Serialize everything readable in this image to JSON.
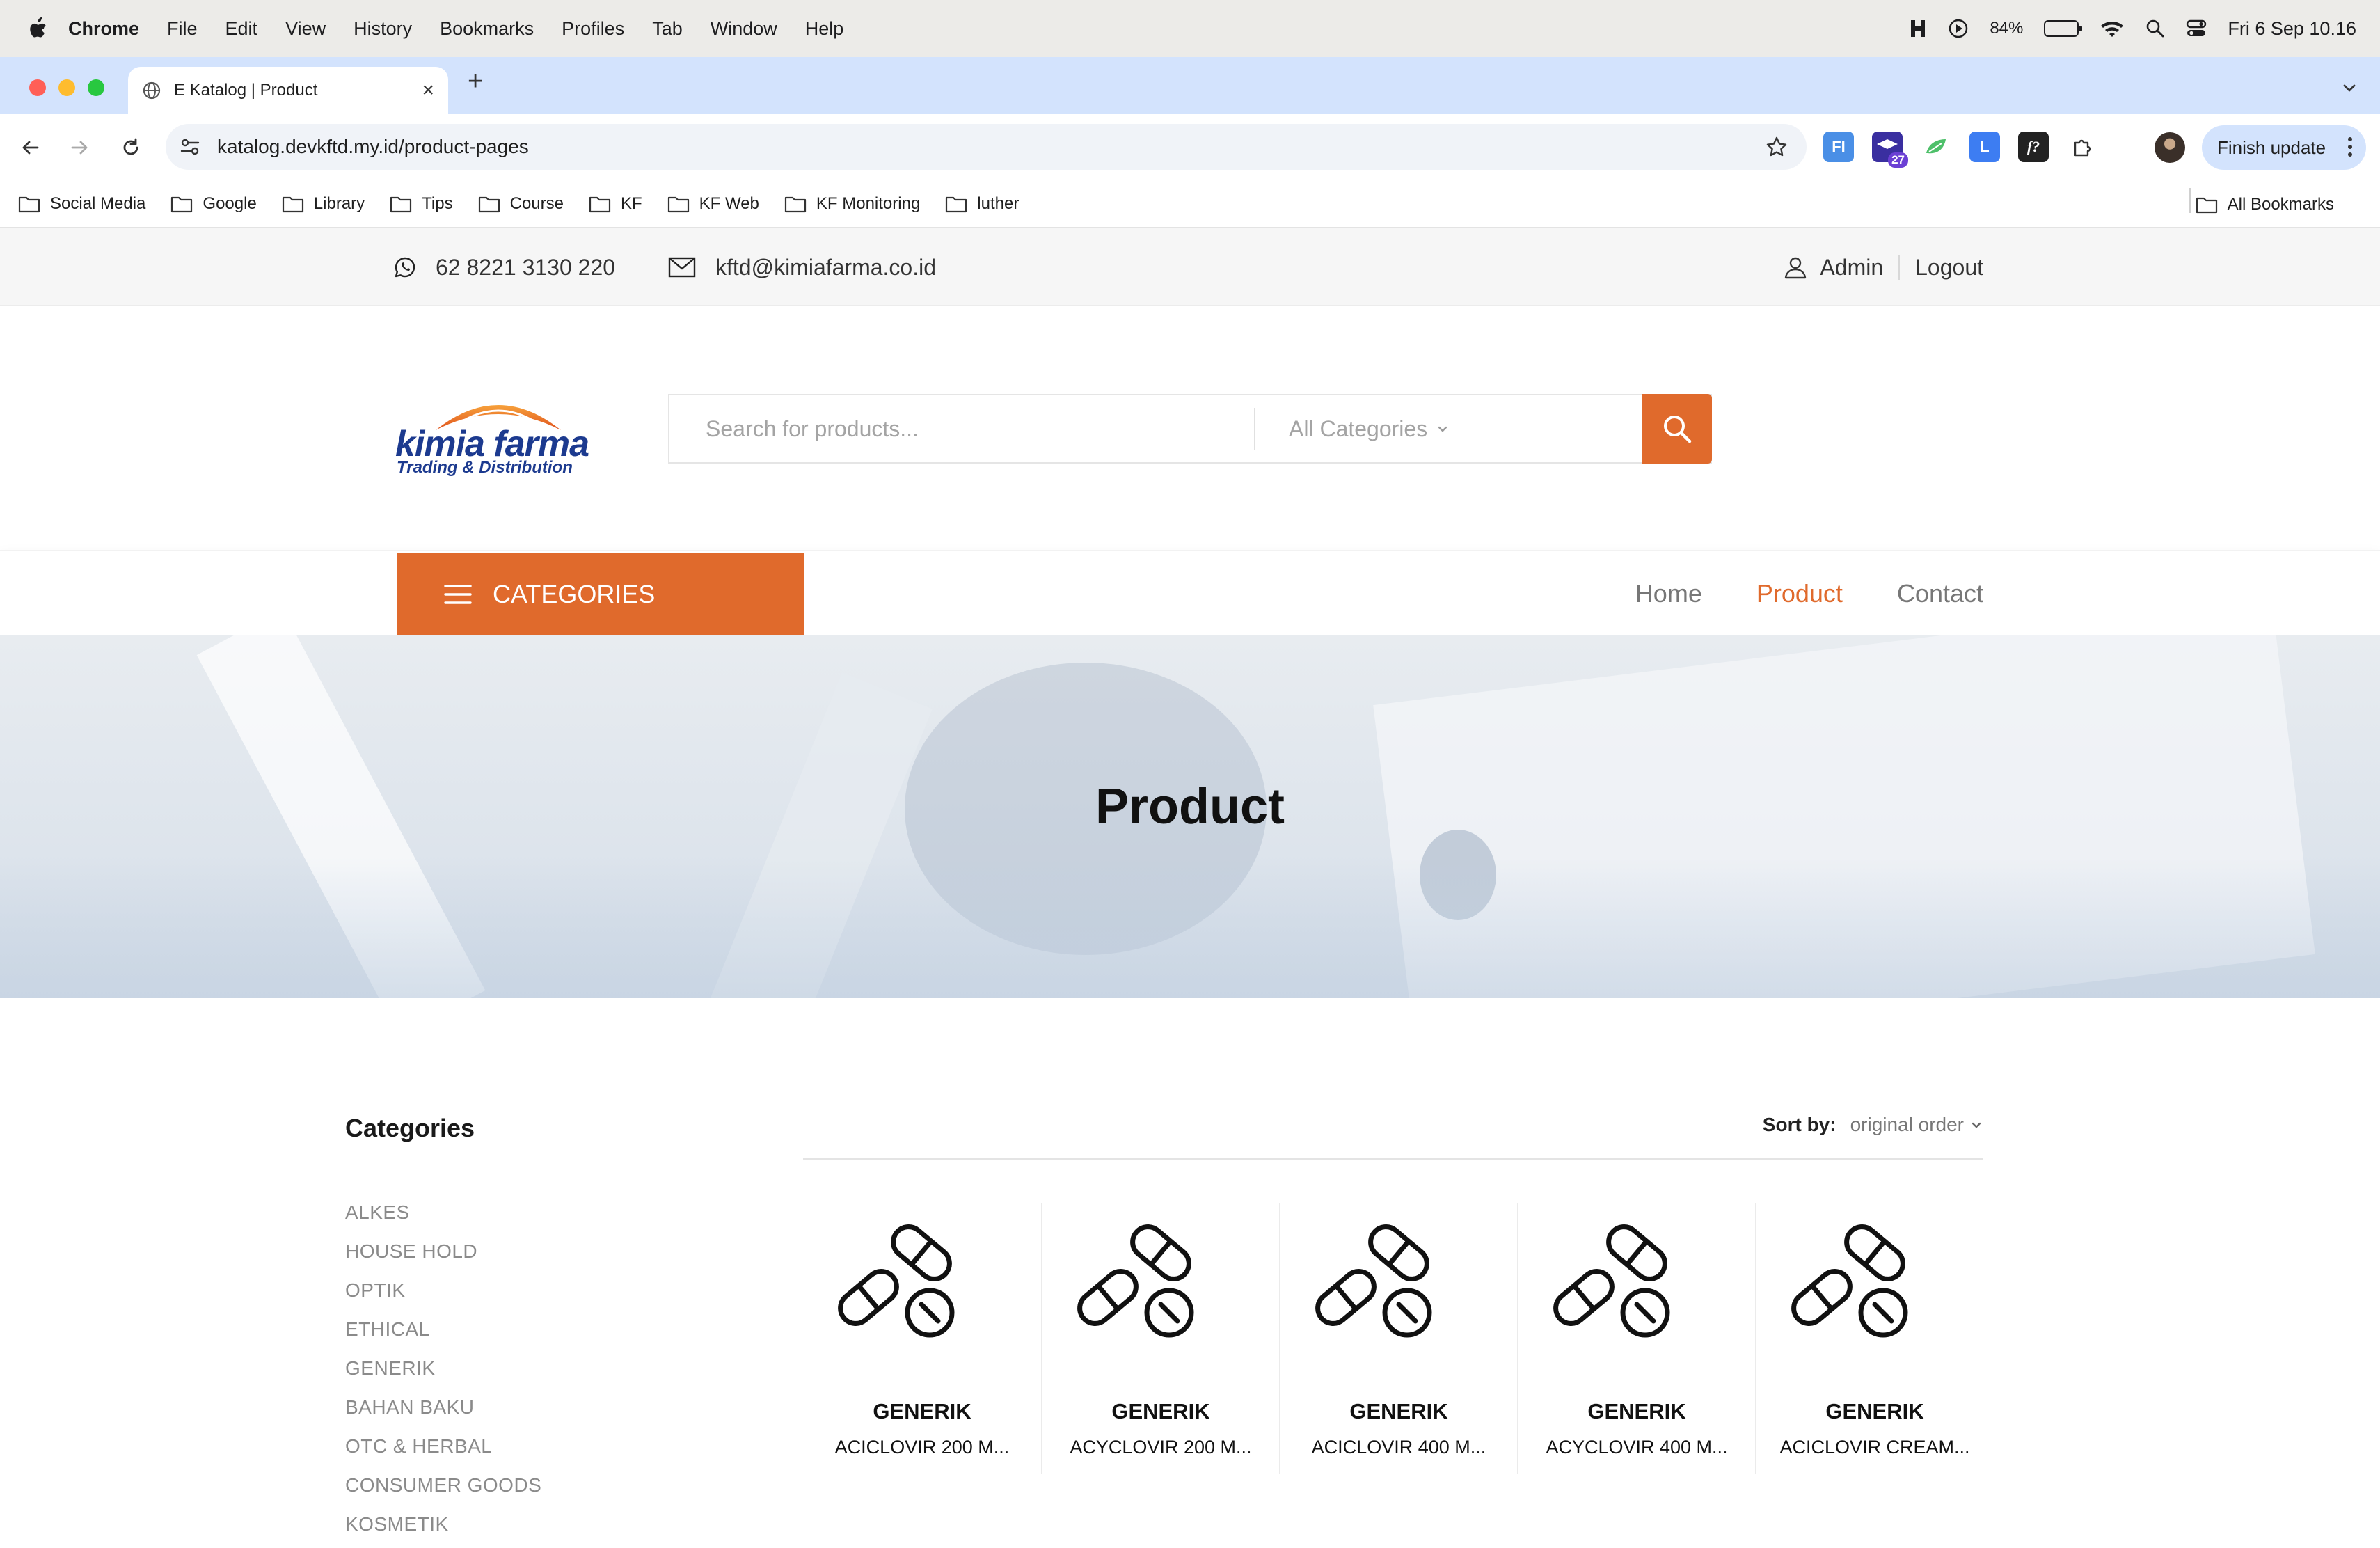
{
  "menubar": {
    "app": "Chrome",
    "items": [
      "File",
      "Edit",
      "View",
      "History",
      "Bookmarks",
      "Profiles",
      "Tab",
      "Window",
      "Help"
    ],
    "battery": "84%",
    "datetime": "Fri 6 Sep  10.16",
    "battery_level": 0.84
  },
  "browser": {
    "tab_title": "E Katalog | Product",
    "url": "katalog.devkftd.my.id/product-pages",
    "finish_update": "Finish update",
    "extension_badge": "27",
    "bookmarks": [
      "Social Media",
      "Google",
      "Library",
      "Tips",
      "Course",
      "KF",
      "KF Web",
      "KF Monitoring",
      "luther"
    ],
    "all_bookmarks": "All Bookmarks"
  },
  "topbar": {
    "phone": "62 8221 3130 220",
    "email": "kftd@kimiafarma.co.id",
    "admin": "Admin",
    "logout": "Logout"
  },
  "header": {
    "logo_word": "kimia farma",
    "logo_sub": "Trading & Distribution",
    "search_placeholder": "Search for products...",
    "category_select": "All Categories"
  },
  "nav": {
    "categories_label": "CATEGORIES",
    "links": [
      "Home",
      "Product",
      "Contact"
    ],
    "active": "Product"
  },
  "hero": {
    "title": "Product"
  },
  "sidebar": {
    "title": "Categories",
    "items": [
      "ALKES",
      "HOUSE HOLD",
      "OPTIK",
      "ETHICAL",
      "GENERIK",
      "BAHAN BAKU",
      "OTC & HERBAL",
      "CONSUMER GOODS",
      "KOSMETIK"
    ]
  },
  "sort": {
    "label": "Sort by:",
    "value": "original order"
  },
  "products": [
    {
      "category": "GENERIK",
      "name": "ACICLOVIR 200 M..."
    },
    {
      "category": "GENERIK",
      "name": "ACYCLOVIR 200 M..."
    },
    {
      "category": "GENERIK",
      "name": "ACICLOVIR 400 M..."
    },
    {
      "category": "GENERIK",
      "name": "ACYCLOVIR 400 M..."
    },
    {
      "category": "GENERIK",
      "name": "ACICLOVIR CREAM..."
    }
  ],
  "colors": {
    "accent": "#e06a2c",
    "brand_blue": "#1c3a8f",
    "tab_strip": "#d3e3fd"
  }
}
